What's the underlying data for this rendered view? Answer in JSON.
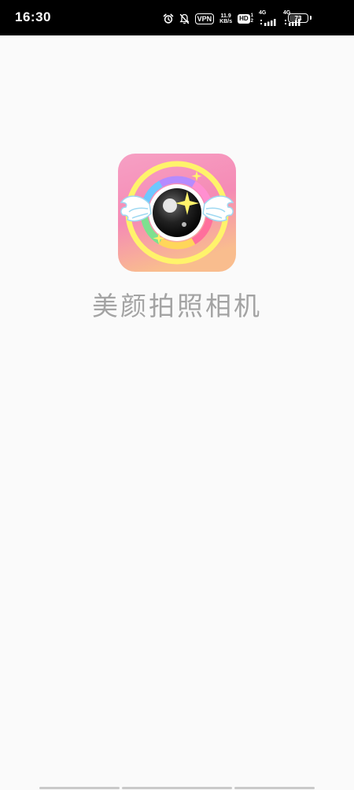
{
  "status_bar": {
    "time": "16:30",
    "vpn_label": "VPN",
    "net_speed_value": "11.9",
    "net_speed_unit": "KB/s",
    "hd_label": "HD",
    "hd_sub_top": "1",
    "hd_sub_bottom": "2",
    "sim1_label": "4G",
    "sim2_label": "4G",
    "battery_level": "73",
    "battery_fraction": 0.73,
    "icons": [
      "alarm-icon",
      "silent-bell-icon",
      "vpn-icon",
      "hd-icon",
      "signal-icon",
      "battery-icon"
    ]
  },
  "splash": {
    "app_name": "美颜拍照相机",
    "icon_name": "camera-lens-with-wings-icon"
  },
  "colors": {
    "status_bar_bg": "#000000",
    "page_bg": "#fafafa",
    "app_name_text": "#a3a3a3",
    "icon_bg_top": "#f7a7c9",
    "icon_bg_bottom": "#f8b98f",
    "icon_ring": "#fff36b",
    "nav_bar": "#c9c9c9"
  }
}
